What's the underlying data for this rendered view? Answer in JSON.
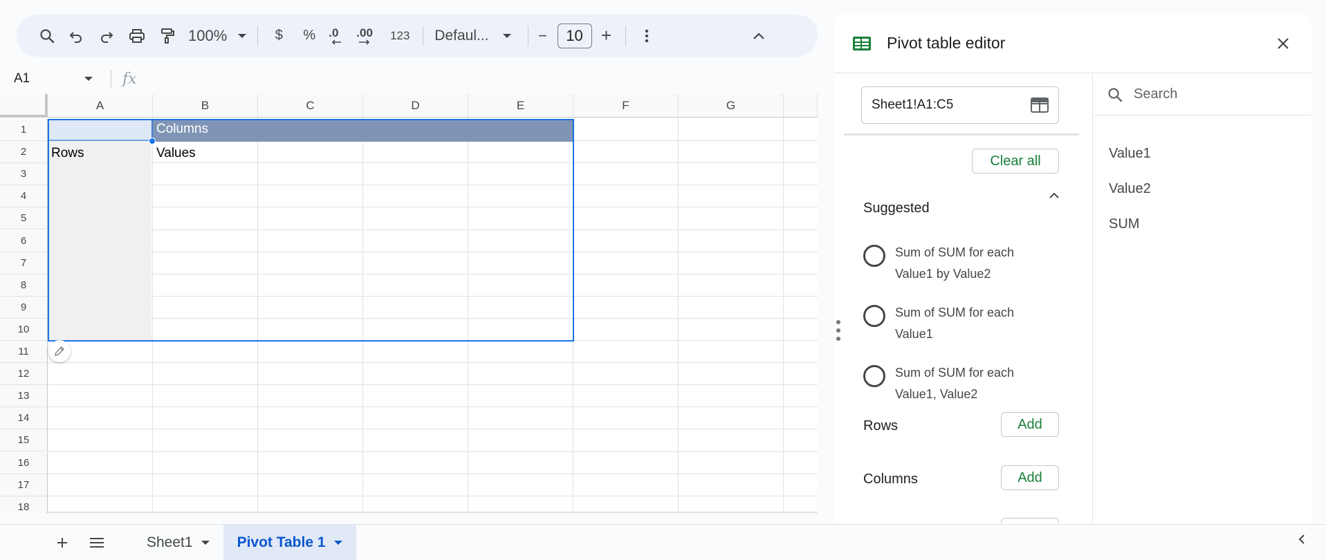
{
  "toolbar": {
    "zoom": "100%",
    "currency": "$",
    "percent": "%",
    "dec_decrease": ".0",
    "dec_increase": ".00",
    "number_format": "123",
    "font": "Defaul...",
    "minus": "−",
    "font_size": "10",
    "plus": "+"
  },
  "formula_bar": {
    "cell_ref": "A1",
    "fx": "fx"
  },
  "grid": {
    "columns": [
      "A",
      "B",
      "C",
      "D",
      "E",
      "F",
      "G"
    ],
    "rows": [
      "1",
      "2",
      "3",
      "4",
      "5",
      "6",
      "7",
      "8",
      "9",
      "10",
      "11",
      "12",
      "13",
      "14",
      "15",
      "16",
      "17",
      "18"
    ],
    "cells": {
      "B1": "Columns",
      "A2": "Rows",
      "B2": "Values"
    }
  },
  "sheets": {
    "tabs": [
      {
        "label": "Sheet1",
        "active": false
      },
      {
        "label": "Pivot Table 1",
        "active": true
      }
    ]
  },
  "panel": {
    "title": "Pivot table editor",
    "range": "Sheet1!A1:C5",
    "clear_all": "Clear all",
    "suggested_title": "Suggested",
    "suggestions": [
      "Sum of SUM for each Value1 by Value2",
      "Sum of SUM for each Value1",
      "Sum of SUM for each Value1, Value2"
    ],
    "rows_label": "Rows",
    "columns_label": "Columns",
    "add_label": "Add",
    "search_placeholder": "Search",
    "fields": [
      "Value1",
      "Value2",
      "SUM"
    ]
  },
  "colors": {
    "accent_blue": "#1a73e8",
    "pivot_header": "#8095b5",
    "green": "#188038",
    "active_tab_bg": "#e1e9f7"
  }
}
